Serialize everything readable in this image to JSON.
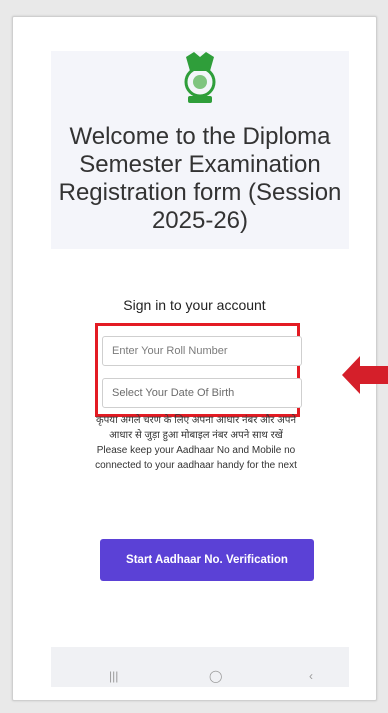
{
  "header": {
    "welcome_title": "Welcome to the Diploma Semester Examination Registration form (Session 2025-26)"
  },
  "signin": {
    "title": "Sign in to your account",
    "roll_placeholder": "Enter Your Roll Number",
    "dob_placeholder": "Select Your Date Of Birth"
  },
  "notice": {
    "hindi": "कृपया अगले चरण के लिए अपना आधार नंबर और अपने आधार से जुड़ा हुआ मोबाइल नंबर अपने साथ रखें",
    "english": "Please keep your Aadhaar No and Mobile no connected to your aadhaar handy for the next"
  },
  "actions": {
    "verify_button": "Start Aadhaar No. Verification"
  },
  "colors": {
    "accent": "#5b41d6",
    "highlight": "#e31b23",
    "logo_green": "#2f9e3a"
  },
  "icons": {
    "logo": "emblem-logo",
    "arrow": "red-left-arrow",
    "nav": [
      "recent-apps-icon",
      "home-icon",
      "back-icon"
    ]
  }
}
